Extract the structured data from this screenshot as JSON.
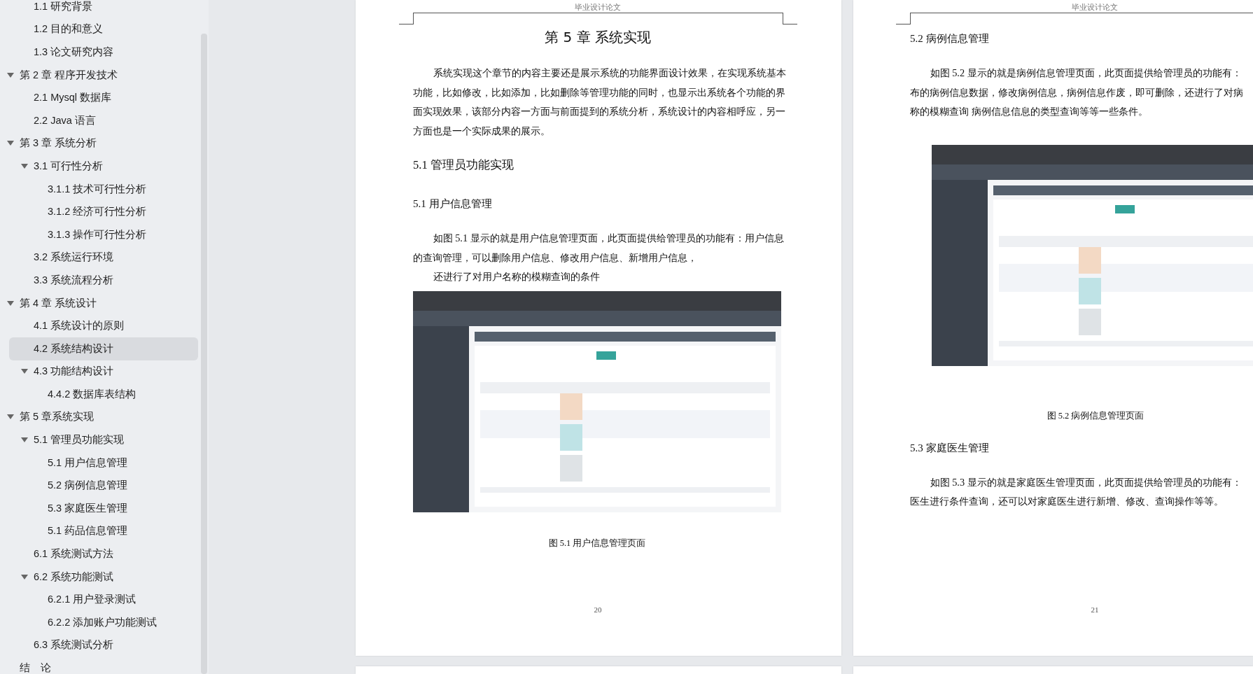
{
  "sidebar": {
    "items": [
      {
        "children": [
          {
            "label": "1.1  研究背景",
            "selected": false
          },
          {
            "label": "1.2 目的和意义",
            "selected": false
          },
          {
            "label": "1.3  论文研究内容",
            "selected": false
          }
        ]
      },
      {
        "label": "第 2 章  程序开发技术",
        "selected": false,
        "expanded": true,
        "children": [
          {
            "label": "2.1 Mysql 数据库",
            "selected": false
          },
          {
            "label": "2.2 Java 语言",
            "selected": false
          }
        ]
      },
      {
        "label": "第 3 章  系统分析",
        "selected": false,
        "expanded": true,
        "children": [
          {
            "label": "3.1 可行性分析",
            "selected": false,
            "expanded": true,
            "children": [
              {
                "label": "3.1.1 技术可行性分析",
                "selected": false
              },
              {
                "label": "3.1.2 经济可行性分析",
                "selected": false
              },
              {
                "label": "3.1.3 操作可行性分析",
                "selected": false
              }
            ]
          },
          {
            "label": "3.2 系统运行环境",
            "selected": false
          },
          {
            "label": "3.3 系统流程分析",
            "selected": false
          }
        ]
      },
      {
        "label": "第 4 章  系统设计",
        "selected": false,
        "expanded": true,
        "children": [
          {
            "label": "4.1  系统设计的原则",
            "selected": false
          },
          {
            "label": "4.2  系统结构设计",
            "selected": true
          },
          {
            "label": "4.3 功能结构设计",
            "selected": false,
            "expanded": true,
            "children": [
              {
                "label": "4.4.2  数据库表结构",
                "selected": false
              }
            ]
          }
        ]
      },
      {
        "label": "第 5 章系统实现",
        "selected": false,
        "expanded": true,
        "children": [
          {
            "label": "5.1 管理员功能实现",
            "selected": false,
            "expanded": true,
            "children": [
              {
                "label": "5.1 用户信息管理",
                "selected": false
              },
              {
                "label": "5.2  病例信息管理",
                "selected": false
              },
              {
                "label": "5.3 家庭医生管理",
                "selected": false
              },
              {
                "label": "5.1 药品信息管理",
                "selected": false
              }
            ]
          },
          {
            "label": "6.1 系统测试方法",
            "selected": false
          },
          {
            "label": "6.2  系统功能测试",
            "selected": false,
            "expanded": true,
            "children": [
              {
                "label": "6.2.1  用户登录测试",
                "selected": false
              },
              {
                "label": "6.2.2  添加账户功能测试",
                "selected": false
              }
            ]
          },
          {
            "label": "6.3  系统测试分析",
            "selected": false
          }
        ]
      },
      {
        "label": "结　论",
        "selected": false
      }
    ]
  },
  "pages": [
    {
      "header": "毕业设计论文",
      "page_number": "20",
      "blocks": [
        {
          "kind": "chapter-title",
          "text": "第 5 章  系统实现"
        },
        {
          "kind": "paragraph",
          "lines": [
            "系统实现这个章节的内容主要还是展示系统的功能界面设计效果，在实现系统基本",
            "功能，比如修改，比如添加，比如删除等管理功能的同时，也显示出系统各个功能的界",
            "面实现效果，该部分内容一方面与前面提到的系统分析，系统设计的内容相呼应，另一",
            "方面也是一个实际成果的展示。"
          ]
        },
        {
          "kind": "section-heading",
          "text": "5.1 管理员功能实现"
        },
        {
          "kind": "subsection-heading",
          "text": "5.1 用户信息管理"
        },
        {
          "kind": "paragraph",
          "lines": [
            "如图 5.1 显示的就是用户信息管理页面，此页面提供给管理员的功能有：用户信息",
            "的查询管理，可以删除用户信息、修改用户信息、新增用户信息，"
          ]
        },
        {
          "kind": "paragraph",
          "lines": [
            "还进行了对用户名称的模糊查询的条件"
          ]
        },
        {
          "kind": "figure",
          "caption": "图 5.1  用户信息管理页面"
        }
      ]
    },
    {
      "header": "毕业设计论文",
      "page_number": "21",
      "blocks": [
        {
          "kind": "subsection-heading",
          "text": "5.2  病例信息管理"
        },
        {
          "kind": "paragraph",
          "lines": [
            "如图 5.2 显示的就是病例信息管理页面，此页面提供给管理员的功能有：",
            "布的病例信息数据，修改病例信息，病例信息作废，即可删除，还进行了对病",
            "称的模糊查询  病例信息信息的类型查询等等一些条件。"
          ]
        },
        {
          "kind": "figure",
          "caption": "图 5.2  病例信息管理页面"
        },
        {
          "kind": "subsection-heading",
          "text": "5.3 家庭医生管理"
        },
        {
          "kind": "paragraph",
          "lines": [
            "如图 5.3 显示的就是家庭医生管理页面，此页面提供给管理员的功能有：",
            "医生进行条件查询，还可以对家庭医生进行新增、修改、查询操作等等。"
          ]
        }
      ]
    }
  ]
}
